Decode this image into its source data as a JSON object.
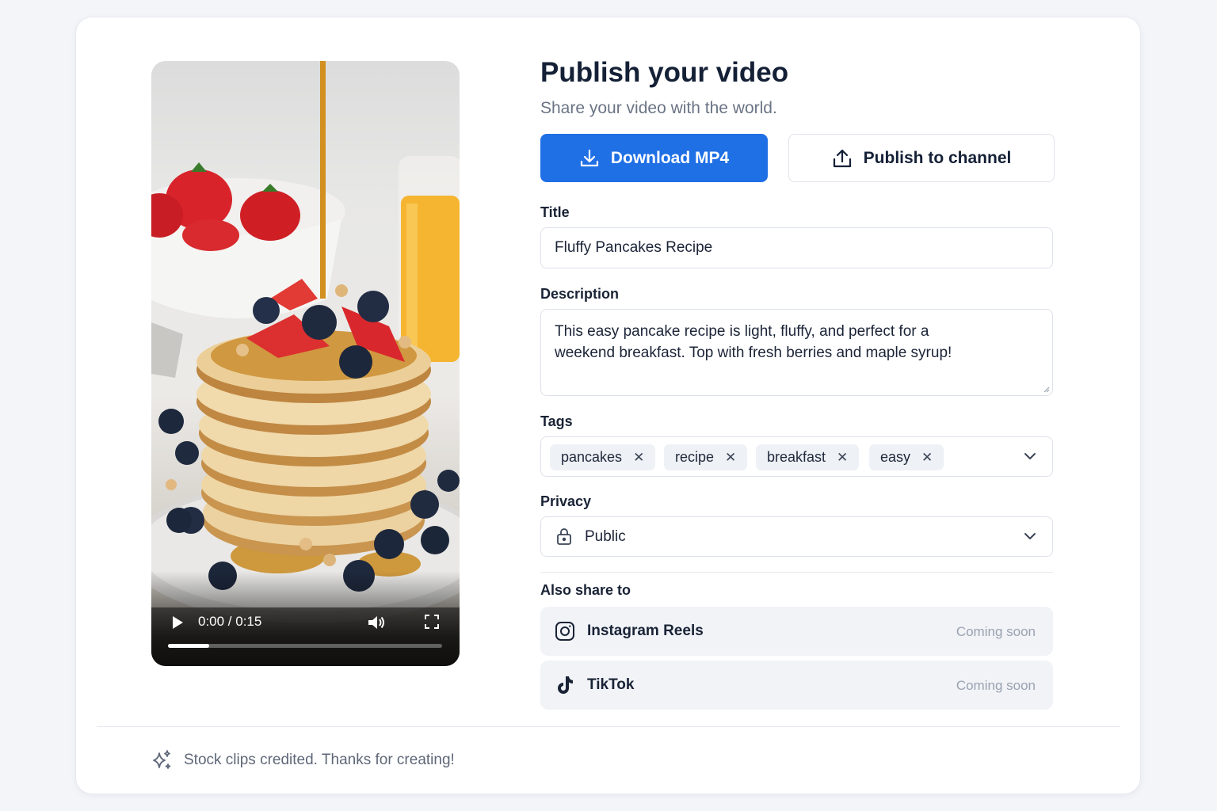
{
  "page": {
    "title": "Publish your video",
    "subtitle": "Share your video with the world."
  },
  "video": {
    "time": "0:00 / 0:15",
    "progress_fraction": 0.15
  },
  "actions": {
    "download_label": "Download MP4",
    "publish_label": "Publish to channel"
  },
  "form": {
    "title_label": "Title",
    "title_value": "Fluffy Pancakes Recipe",
    "description_label": "Description",
    "description_value": "This easy pancake recipe is light, fluffy, and perfect for a weekend breakfast. Top with fresh berries and maple syrup!",
    "tags_label": "Tags",
    "tags": [
      "pancakes",
      "recipe",
      "breakfast",
      "easy"
    ],
    "tag_remove_glyph": "✕",
    "privacy_label": "Privacy",
    "privacy_value": "Public"
  },
  "share": {
    "heading": "Also share to",
    "items": [
      {
        "name": "Instagram Reels",
        "status": "Coming soon",
        "icon": "instagram-icon"
      },
      {
        "name": "TikTok",
        "status": "Coming soon",
        "icon": "tiktok-icon"
      }
    ]
  },
  "footer": {
    "text": "Stock clips credited. Thanks for creating!",
    "icon": "sparkles-icon"
  },
  "colors": {
    "primary": "#1f6fe5",
    "background": "#f3f5f9",
    "card": "#ffffff",
    "muted": "#9aa2b0"
  }
}
